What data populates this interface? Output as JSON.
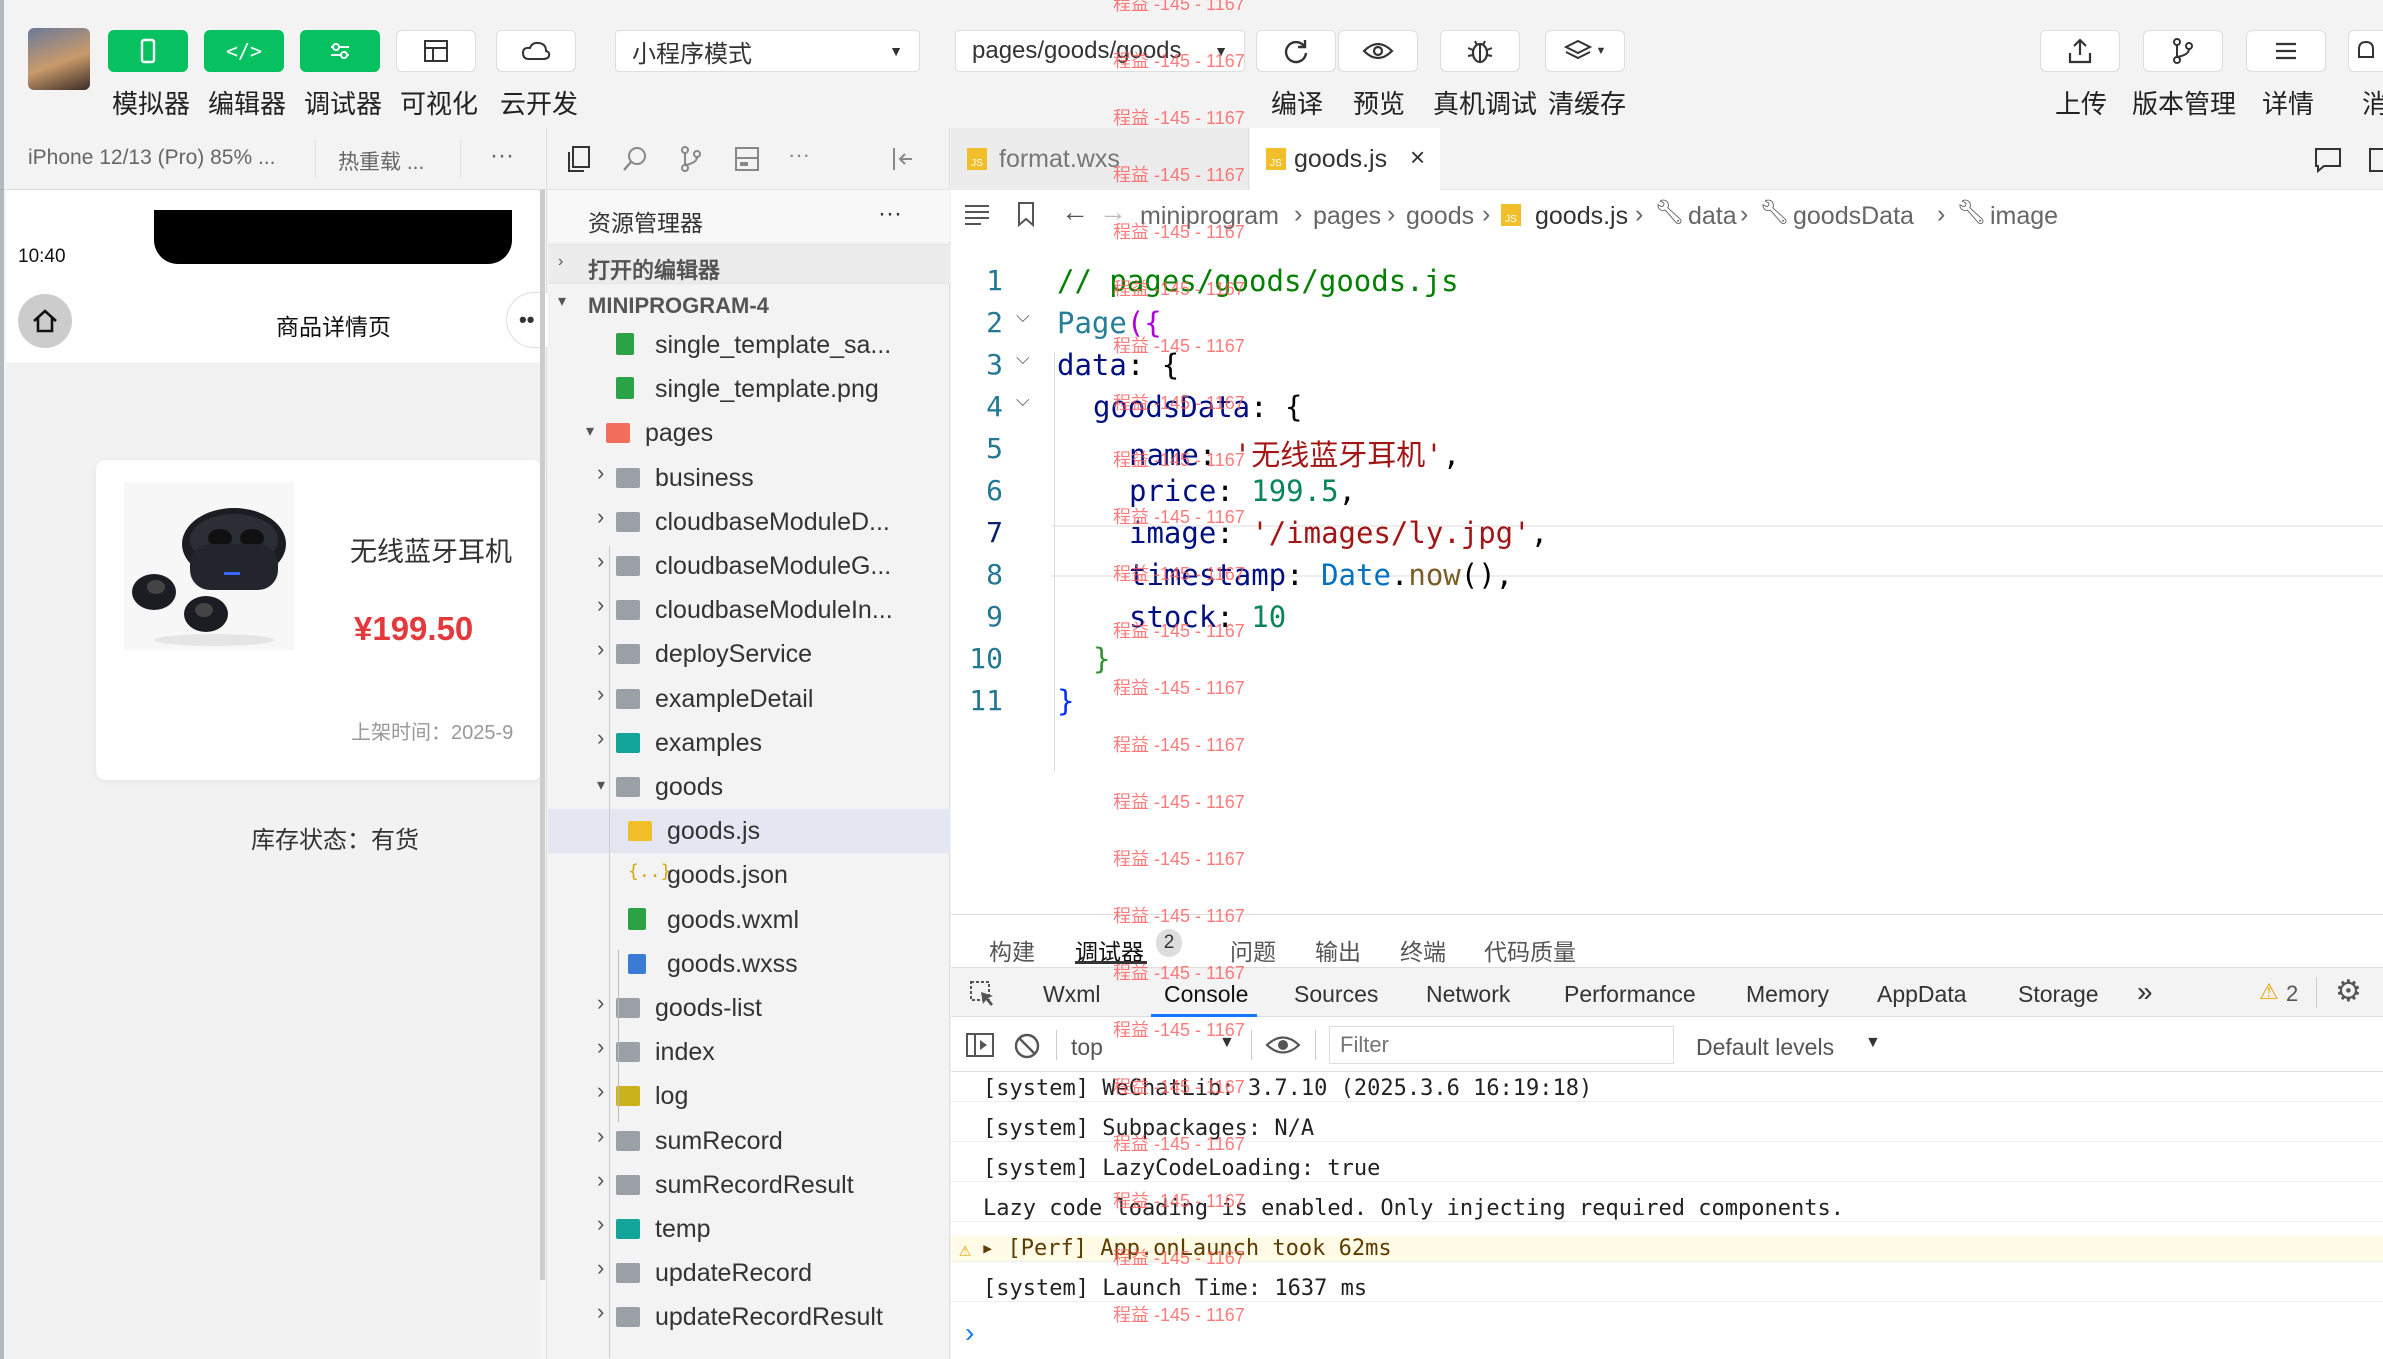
{
  "toolbar": {
    "buttons": [
      {
        "label": "模拟器",
        "icon": "phone-icon"
      },
      {
        "label": "编辑器",
        "icon": "code-icon"
      },
      {
        "label": "调试器",
        "icon": "sliders-icon"
      },
      {
        "label": "可视化",
        "icon": "layout-icon"
      },
      {
        "label": "云开发",
        "icon": "cloud-icon"
      }
    ],
    "mode_select": "小程序模式",
    "page_select": "pages/goods/goods",
    "actions": [
      {
        "label": "编译",
        "icon": "refresh-icon"
      },
      {
        "label": "预览",
        "icon": "eye-icon"
      },
      {
        "label": "真机调试",
        "icon": "bug-icon"
      },
      {
        "label": "清缓存",
        "icon": "layers-icon"
      }
    ],
    "right_actions": [
      {
        "label": "上传",
        "icon": "upload-icon"
      },
      {
        "label": "版本管理",
        "icon": "branch-icon"
      },
      {
        "label": "详情",
        "icon": "menu-icon"
      },
      {
        "label": "消",
        "icon": "bell-icon"
      }
    ]
  },
  "simulator": {
    "device": "iPhone 12/13 (Pro) 85% ...",
    "hot_reload": "热重载 ...",
    "more": "···",
    "time": "10:40",
    "nav_title": "商品详情页",
    "product_name": "无线蓝牙耳机",
    "price": "¥199.50",
    "shelf_time": "上架时间：2025-9",
    "stock_status": "库存状态：有货"
  },
  "explorer": {
    "title": "资源管理器",
    "more": "···",
    "open_editors": "打开的编辑器",
    "project": "MINIPROGRAM-4",
    "items": [
      {
        "label": "single_template_sa...",
        "type": "image",
        "indent": 2,
        "arrow": ""
      },
      {
        "label": "single_template.png",
        "type": "image",
        "indent": 2,
        "arrow": ""
      },
      {
        "label": "pages",
        "type": "folder-red",
        "indent": 1,
        "arrow": "▾"
      },
      {
        "label": "business",
        "type": "folder",
        "indent": 2,
        "arrow": "›"
      },
      {
        "label": "cloudbaseModuleD...",
        "type": "folder",
        "indent": 2,
        "arrow": "›"
      },
      {
        "label": "cloudbaseModuleG...",
        "type": "folder",
        "indent": 2,
        "arrow": "›"
      },
      {
        "label": "cloudbaseModuleIn...",
        "type": "folder",
        "indent": 2,
        "arrow": "›"
      },
      {
        "label": "deployService",
        "type": "folder",
        "indent": 2,
        "arrow": "›"
      },
      {
        "label": "exampleDetail",
        "type": "folder",
        "indent": 2,
        "arrow": "›"
      },
      {
        "label": "examples",
        "type": "folder-teal",
        "indent": 2,
        "arrow": "›"
      },
      {
        "label": "goods",
        "type": "folder-open",
        "indent": 2,
        "arrow": "▾"
      },
      {
        "label": "goods.js",
        "type": "js",
        "indent": 3,
        "arrow": "",
        "selected": true
      },
      {
        "label": "goods.json",
        "type": "json",
        "indent": 3,
        "arrow": ""
      },
      {
        "label": "goods.wxml",
        "type": "wxml",
        "indent": 3,
        "arrow": ""
      },
      {
        "label": "goods.wxss",
        "type": "wxss",
        "indent": 3,
        "arrow": ""
      },
      {
        "label": "goods-list",
        "type": "folder",
        "indent": 2,
        "arrow": "›"
      },
      {
        "label": "index",
        "type": "folder",
        "indent": 2,
        "arrow": "›"
      },
      {
        "label": "log",
        "type": "folder-yellow",
        "indent": 2,
        "arrow": "›"
      },
      {
        "label": "sumRecord",
        "type": "folder",
        "indent": 2,
        "arrow": "›"
      },
      {
        "label": "sumRecordResult",
        "type": "folder",
        "indent": 2,
        "arrow": "›"
      },
      {
        "label": "temp",
        "type": "folder-teal",
        "indent": 2,
        "arrow": "›"
      },
      {
        "label": "updateRecord",
        "type": "folder",
        "indent": 2,
        "arrow": "›"
      },
      {
        "label": "updateRecordResult",
        "type": "folder",
        "indent": 2,
        "arrow": "›"
      }
    ]
  },
  "editor": {
    "tabs": [
      {
        "label": "format.wxs",
        "active": false
      },
      {
        "label": "goods.js",
        "active": true
      }
    ],
    "breadcrumb": [
      "miniprogram",
      "pages",
      "goods",
      "goods.js",
      "data",
      "goodsData",
      "image"
    ],
    "lines": [
      "1",
      "2",
      "3",
      "4",
      "5",
      "6",
      "7",
      "8",
      "9",
      "10",
      "11"
    ],
    "code": {
      "l1": "// pages/goods/goods.js",
      "l2a": "Page",
      "l2b": "({",
      "l3a": "data",
      "l3b": ": {",
      "l4a": "goodsData",
      "l4b": ": {",
      "l5a": "name",
      "l5b": ": ",
      "l5c": "'无线蓝牙耳机'",
      "l5d": ",",
      "l6a": "price",
      "l6b": ": ",
      "l6c": "199.5",
      "l6d": ",",
      "l7a": "image",
      "l7b": ": ",
      "l7c": "'/images/ly.jpg'",
      "l7d": ",",
      "l8a": "timestamp",
      "l8b": ": ",
      "l8c": "Date",
      "l8d": ".",
      "l8e": "now",
      "l8f": "(),",
      "l9a": "stock",
      "l9b": ": ",
      "l9c": "10",
      "l10": "}",
      "l11": "}"
    }
  },
  "bottom": {
    "tabs": [
      "构建",
      "调试器",
      "问题",
      "输出",
      "终端",
      "代码质量"
    ],
    "debugger_badge": "2",
    "devtabs": [
      "Wxml",
      "Console",
      "Sources",
      "Network",
      "Performance",
      "Memory",
      "AppData",
      "Storage"
    ],
    "more": "»",
    "warn_count": "2",
    "context": "top",
    "filter_placeholder": "Filter",
    "levels": "Default levels",
    "logs": [
      {
        "text": "[system] WeChatLib: 3.7.10 (2025.3.6 16:19:18)",
        "warn": false
      },
      {
        "text": "[system] Subpackages: N/A",
        "warn": false
      },
      {
        "text": "[system] LazyCodeLoading: true",
        "warn": false
      },
      {
        "text": "Lazy code loading is enabled. Only injecting required components.",
        "warn": false
      },
      {
        "text": "▸ [Perf] App.onLaunch took 62ms",
        "warn": true
      },
      {
        "text": "[system] Launch Time: 1637 ms",
        "warn": false
      }
    ],
    "prompt": "›"
  },
  "watermark": "程益 -145 - 1167",
  "colors": {
    "green": "#07c160",
    "accent": "#1677ff",
    "folder": "#9aa0a6",
    "js": "#f1bf2a"
  }
}
